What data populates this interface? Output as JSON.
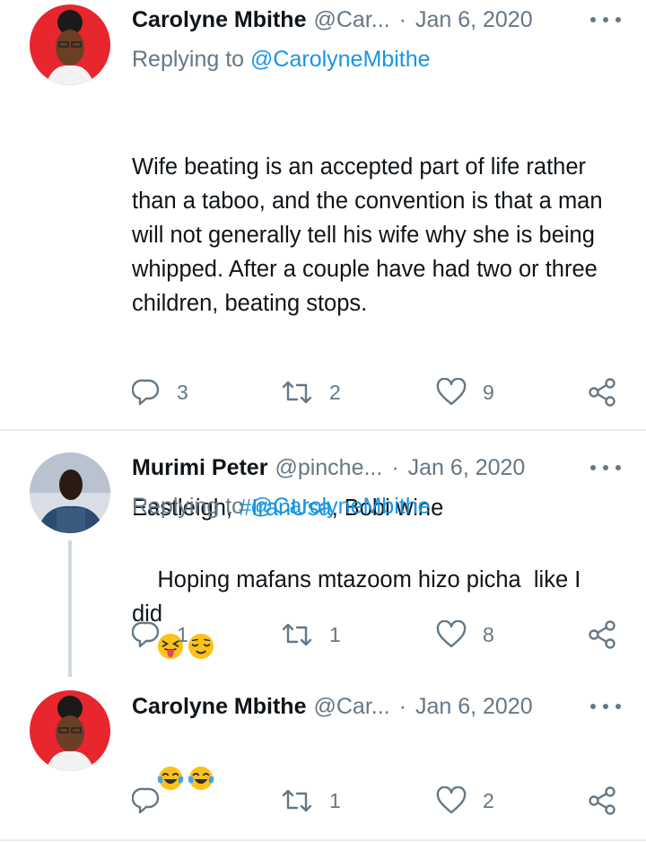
{
  "tweets": [
    {
      "name": "Carolyne Mbithe",
      "handle": "@Car...",
      "date": "Jan 6, 2020",
      "reply_label": "Replying to",
      "reply_handle": "@CarolyneMbithe",
      "text": "Wife beating is an accepted part of life rather than a taboo, and the convention is that a man will not generally tell his wife why she is being whipped. After a couple have had two or three children, beating stops.",
      "tags_prefix": "Eastleigh, ",
      "hashtag": "#IranUsa",
      "tags_suffix": ", Bobi wine",
      "replies": "3",
      "retweets": "2",
      "likes": "9"
    },
    {
      "name": "Murimi Peter",
      "handle": "@pinche...",
      "date": "Jan 6, 2020",
      "reply_label": "Replying to",
      "reply_handle": "@CarolyneMbithe",
      "text": "Hoping mafans mtazoom hizo picha  like I did",
      "emojis": [
        "squinting-tongue-emoji",
        "relieved-face-emoji"
      ],
      "replies": "1",
      "retweets": "1",
      "likes": "8"
    },
    {
      "name": "Carolyne Mbithe",
      "handle": "@Car...",
      "date": "Jan 6, 2020",
      "emojis": [
        "tears-of-joy-emoji",
        "tears-of-joy-emoji"
      ],
      "replies": "",
      "retweets": "1",
      "likes": "2"
    }
  ],
  "colors": {
    "link": "#1b95e0",
    "secondary_text": "#657786",
    "divider": "#e6ecf0",
    "avatar_bg": "#e8262e"
  },
  "icons": [
    "reply-icon",
    "retweet-icon",
    "like-icon",
    "share-icon",
    "more-options-icon"
  ]
}
